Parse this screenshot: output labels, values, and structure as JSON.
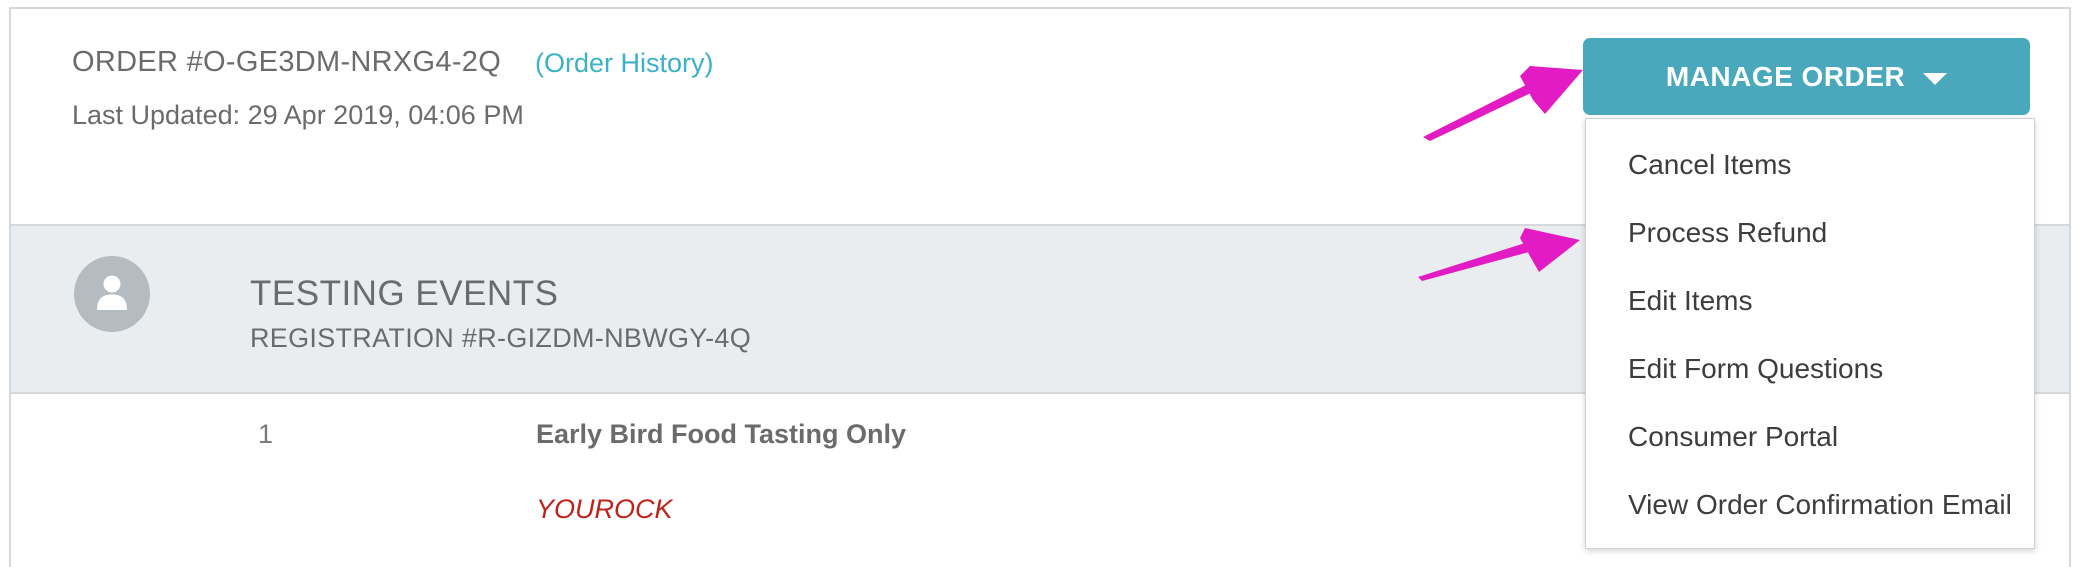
{
  "order": {
    "title": "ORDER #O-GE3DM-NRXG4-2Q",
    "history_link": "(Order History)",
    "last_updated": "Last Updated: 29 Apr 2019, 04:06 PM"
  },
  "registration": {
    "event_name": "TESTING EVENTS",
    "registration_number": "REGISTRATION #R-GIZDM-NBWGY-4Q",
    "avatar_icon": "user-icon"
  },
  "line_item": {
    "quantity": "1",
    "name": "Early Bird Food Tasting Only",
    "promo_code": "YOUROCK"
  },
  "manage_order": {
    "button_label": "MANAGE ORDER",
    "menu_items": [
      "Cancel Items",
      "Process Refund",
      "Edit Items",
      "Edit Form Questions",
      "Consumer Portal",
      "View Order Confirmation Email"
    ]
  },
  "colors": {
    "accent": "#4aa8bc",
    "link": "#3bb1c6",
    "promo": "#c0231c",
    "annotation_arrow": "#e21bc4",
    "band": "#eaedf0"
  },
  "annotations": {
    "arrow_icon": "annotation-arrow-icon"
  }
}
